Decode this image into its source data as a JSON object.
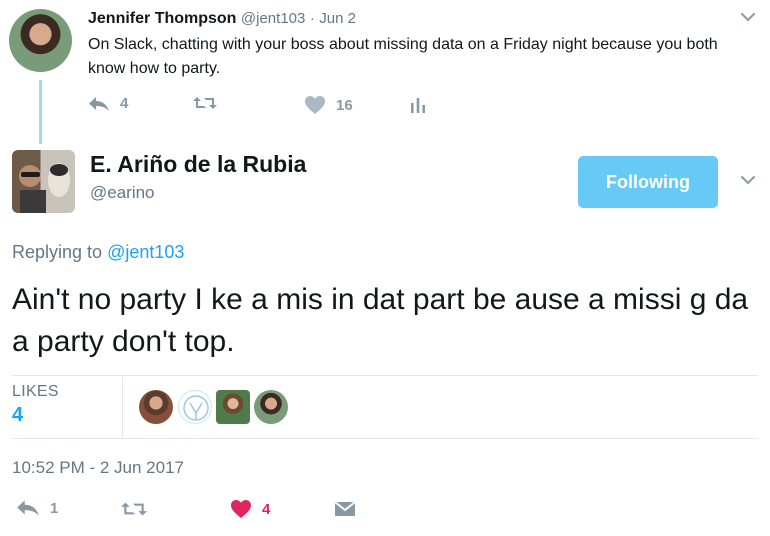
{
  "parent_tweet": {
    "author_name": "Jennifer Thompson",
    "handle": "@jent103",
    "separator": "·",
    "time": "Jun 2",
    "text": "On Slack, chatting with your boss about missing data on a Friday night because you both know how to party.",
    "reply_count": "4",
    "retweet_count": "",
    "like_count": "16"
  },
  "main_tweet": {
    "author_name": "E. Ariño de la Rubia",
    "handle": "@earino",
    "follow_label": "Following",
    "replying_prefix": "Replying to",
    "replying_mention": "@jent103",
    "text": "Ain't no party I ke a mis in  dat  part be ause a missi g da a party don't  top.",
    "likes_label": "LIKES",
    "likes_count": "4",
    "timestamp": "10:52 PM - 2 Jun 2017",
    "reply_count": "1",
    "retweet_count": "",
    "like_count": "4"
  },
  "colors": {
    "accent": "#1da1f2",
    "follow_button": "#67c9f6",
    "liked": "#e0245e",
    "muted": "#657786",
    "thread_line": "#9fd8f0"
  },
  "icons": {
    "reply": "reply-icon",
    "retweet": "retweet-icon",
    "like": "heart-icon",
    "analytics": "analytics-icon",
    "dm": "envelope-icon",
    "more": "chevron-down-icon"
  }
}
